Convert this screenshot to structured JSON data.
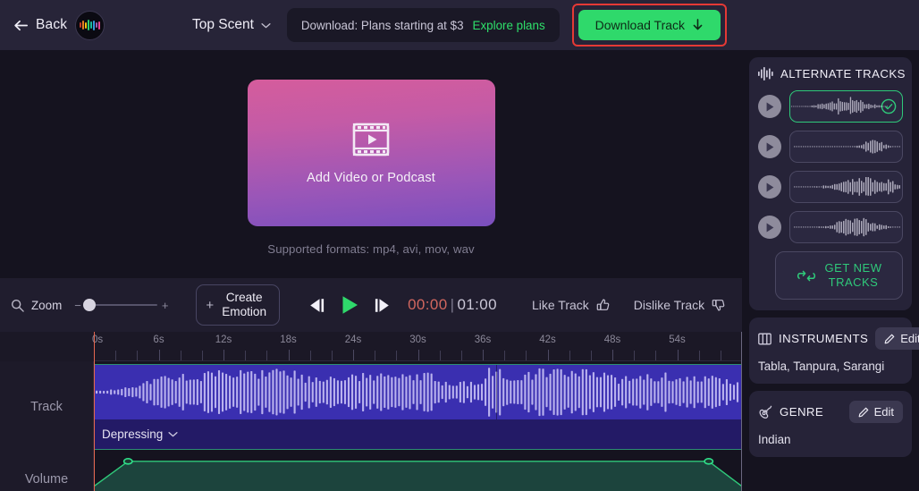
{
  "header": {
    "back_label": "Back",
    "back_icon": "arrow-left-icon",
    "logo_icon": "app-logo-waveform",
    "project_title": "Top Scent",
    "project_chevron_icon": "chevron-down-icon",
    "promo_text": "Download: Plans starting at $3",
    "promo_link": "Explore plans",
    "download_label": "Download Track",
    "download_icon": "download-arrow-icon",
    "highlight_color": "#e53935",
    "accent_green": "#2fd96b"
  },
  "stage": {
    "drop_label": "Add Video or Podcast",
    "drop_icon": "film-play-icon",
    "formats": "Supported formats: mp4, avi, mov, wav",
    "gradient_from": "#d55c9c",
    "gradient_to": "#7a4fbe"
  },
  "toolbar": {
    "zoom_icon": "magnifier-icon",
    "zoom_label": "Zoom",
    "zoom_minus": "−",
    "zoom_plus": "+",
    "zoom_value": 0,
    "create_plus": "+",
    "create_line1": "Create",
    "create_line2": "Emotion",
    "prev_icon": "skip-previous-icon",
    "play_icon": "play-icon",
    "next_icon": "skip-next-icon",
    "time_current": "00:00",
    "time_separator": "|",
    "time_total": "01:00",
    "like_label": "Like Track",
    "like_icon": "thumbs-up-icon",
    "dislike_label": "Dislike Track",
    "dislike_icon": "thumbs-down-icon"
  },
  "timeline": {
    "ruler_labels": [
      "0s",
      "6s",
      "12s",
      "18s",
      "24s",
      "30s",
      "36s",
      "42s",
      "48s",
      "54s"
    ],
    "ruler_seconds": [
      0,
      6,
      12,
      18,
      24,
      30,
      36,
      42,
      48,
      54
    ],
    "total_seconds": 60,
    "playhead_seconds": 0,
    "track_row_label": "Track",
    "volume_row_label": "Volume",
    "emotion_label": "Depressing",
    "emotion_chevron_icon": "chevron-down-icon",
    "clip_color": "#3a2fb0",
    "emotion_bar_color": "#231a66",
    "volume_color": "#2fc97a",
    "playhead_color": "#e4674f"
  },
  "sidebar": {
    "alternate": {
      "icon": "equalizer-icon",
      "title": "ALTERNATE TRACKS",
      "tracks": [
        {
          "play_icon": "play-icon",
          "selected": true,
          "check_icon": "check-circle-icon"
        },
        {
          "play_icon": "play-icon",
          "selected": false,
          "check_icon": ""
        },
        {
          "play_icon": "play-icon",
          "selected": false,
          "check_icon": ""
        },
        {
          "play_icon": "play-icon",
          "selected": false,
          "check_icon": ""
        }
      ],
      "get_new_icon": "refresh-icon",
      "get_new_line1": "GET NEW",
      "get_new_line2": "TRACKS"
    },
    "instruments": {
      "icon": "keyboard-icon",
      "title": "INSTRUMENTS",
      "edit_label": "Edit",
      "edit_icon": "pencil-icon",
      "value": "Tabla, Tanpura, Sarangi"
    },
    "genre": {
      "icon": "guitar-icon",
      "title": "GENRE",
      "edit_label": "Edit",
      "edit_icon": "pencil-icon",
      "value": "Indian"
    }
  }
}
